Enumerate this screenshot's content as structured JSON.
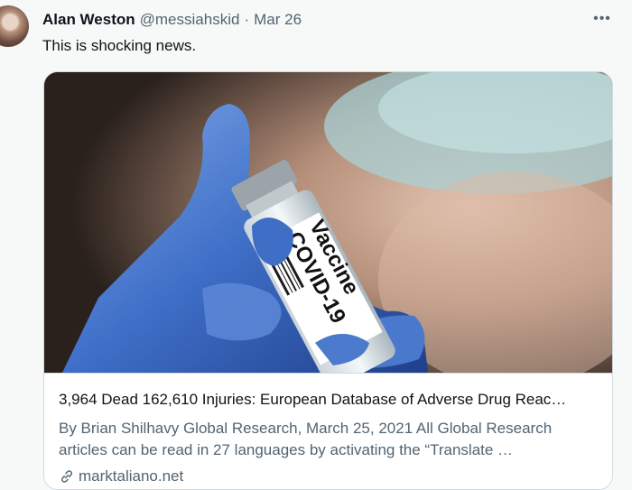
{
  "tweet": {
    "author_name": "Alan Weston",
    "handle": "@messiahskid",
    "separator": "·",
    "date": "Mar 26",
    "more_label": "•••",
    "text": "This is shocking news."
  },
  "card": {
    "image_label_line1": "COVID-19",
    "image_label_line2": "Vaccine",
    "title": "3,964 Dead 162,610 Injuries: European Database of Adverse Drug Reac…",
    "description_line1": "By Brian Shilhavy Global Research, March 25, 2021 All Global Research",
    "description_line2": "articles can be read in 27 languages by activating the “Translate …",
    "domain": "marktaliano.net",
    "link_icon": "link-icon"
  },
  "colors": {
    "background": "#f7f9f9",
    "text_primary": "#0f1419",
    "text_secondary": "#536471",
    "border": "#cfd9de"
  }
}
